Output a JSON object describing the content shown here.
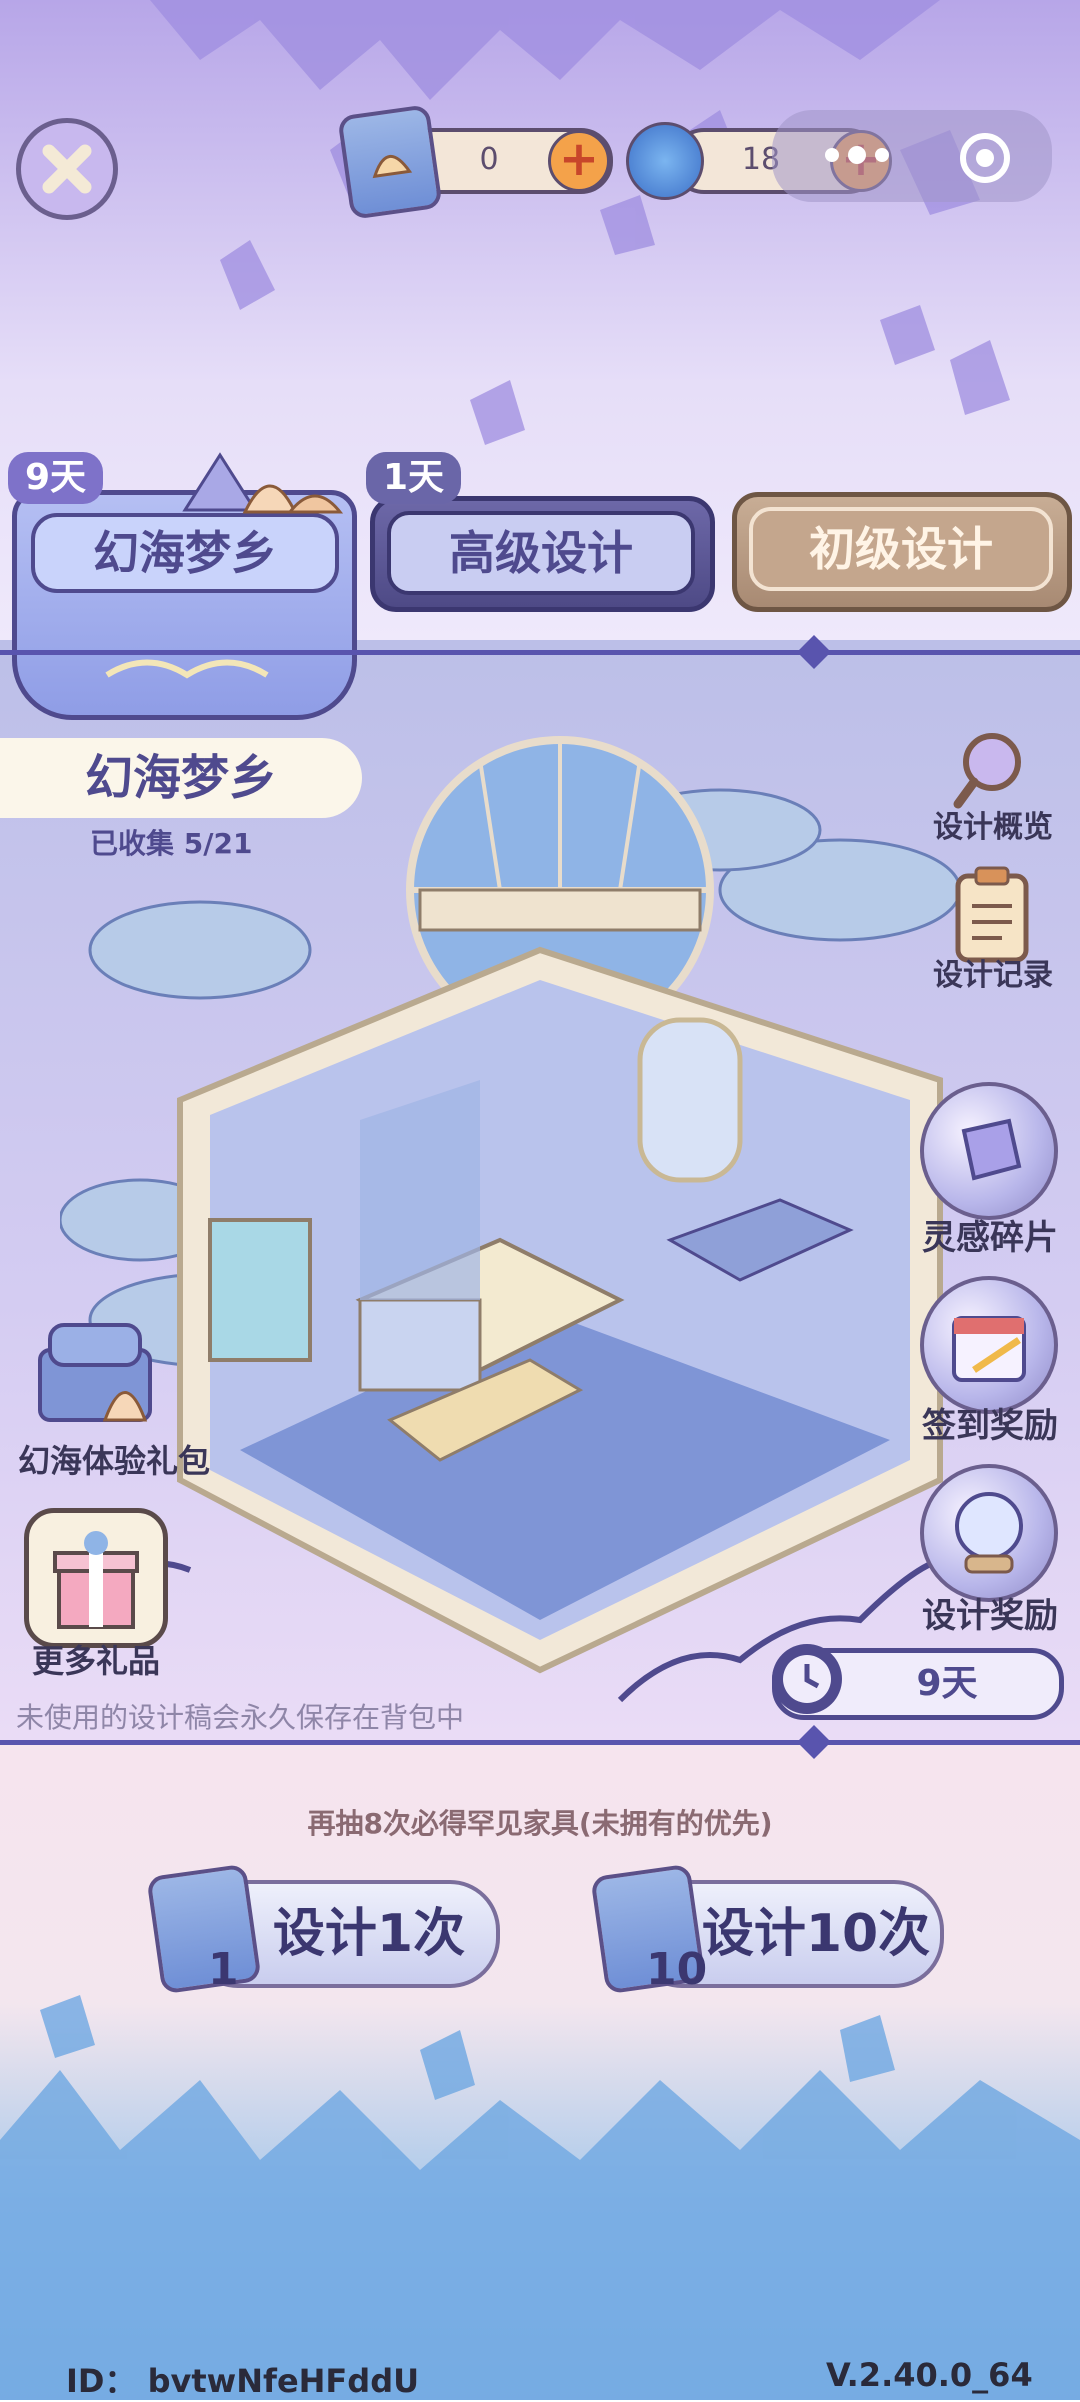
{
  "header": {
    "currency1": {
      "value": "0",
      "icon": "design-scroll-icon"
    },
    "currency2": {
      "value": "18",
      "icon": "spiral-shell-icon"
    },
    "close_icon": "close-icon",
    "more_icon": "more-dots-icon",
    "target_icon": "target-icon"
  },
  "tabs": [
    {
      "label": "幻海梦乡",
      "badge": "9天"
    },
    {
      "label": "高级设计",
      "badge": "1天"
    },
    {
      "label": "初级设计",
      "badge": ""
    }
  ],
  "collection": {
    "title": "幻海梦乡",
    "progress_text": "已收集 5/21",
    "collected": 5,
    "total": 21
  },
  "side_right": {
    "overview": "设计概览",
    "records": "设计记录",
    "inspiration": "灵感碎片",
    "checkin": "签到奖励",
    "reward": "设计奖励"
  },
  "side_left": {
    "gift_pack": "幻海体验礼包",
    "more_gifts": "更多礼品"
  },
  "timer": "9天",
  "save_note": "未使用的设计稿会永久保存在背包中",
  "guarantee_note": "再抽8次必得罕见家具(未拥有的优先)",
  "draw": {
    "single": {
      "label": "设计1次",
      "cost": "1"
    },
    "ten": {
      "label": "设计10次",
      "cost": "10"
    }
  },
  "footer": {
    "id_text": "ID：  bvtwNfeHFddU",
    "version": "V.2.40.0_64"
  },
  "colors": {
    "accent": "#5954ae",
    "tab_active": "#a3aef0",
    "tab_dark": "#5c5590",
    "tab_beige": "#b99b82"
  }
}
